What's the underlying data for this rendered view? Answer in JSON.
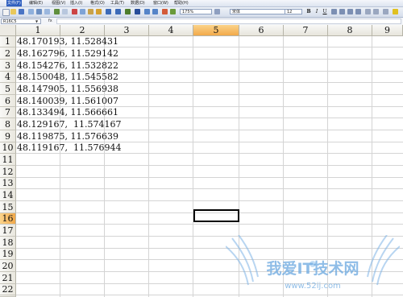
{
  "menubar": {
    "items": [
      "文件(F)",
      "编辑(E)",
      "视图(V)",
      "插入(I)",
      "格式(O)",
      "工具(T)",
      "数据(D)",
      "窗口(W)",
      "帮助(H)"
    ]
  },
  "toolbar": {
    "zoom": "175%",
    "font_name": "宋体",
    "font_size": "12",
    "bold": "B",
    "italic": "I",
    "underline": "U"
  },
  "formula_bar": {
    "name_box": "R16C5",
    "fx": "fx",
    "formula": ""
  },
  "columns": [
    "1",
    "2",
    "3",
    "4",
    "5",
    "6",
    "7",
    "8",
    "9"
  ],
  "selected_column": "5",
  "selected_row": "16",
  "rows": [
    "1",
    "2",
    "3",
    "4",
    "5",
    "6",
    "7",
    "8",
    "9",
    "10",
    "11",
    "12",
    "13",
    "14",
    "15",
    "16",
    "17",
    "18",
    "19",
    "20",
    "21",
    "22",
    "23"
  ],
  "cells_col1": [
    "48.170193, 11.528431",
    "48.162796, 11.529142",
    "48.154276, 11.532822",
    "48.150048, 11.545582",
    "48.147905, 11.556938",
    "48.140039, 11.561007",
    "48.133494, 11.566661",
    "48.129167,  11.574167",
    "48.119875, 11.576639",
    "48.119167,  11.576944"
  ],
  "watermark": {
    "text": "我爱IT技术网",
    "url": "www.52ij.com"
  }
}
